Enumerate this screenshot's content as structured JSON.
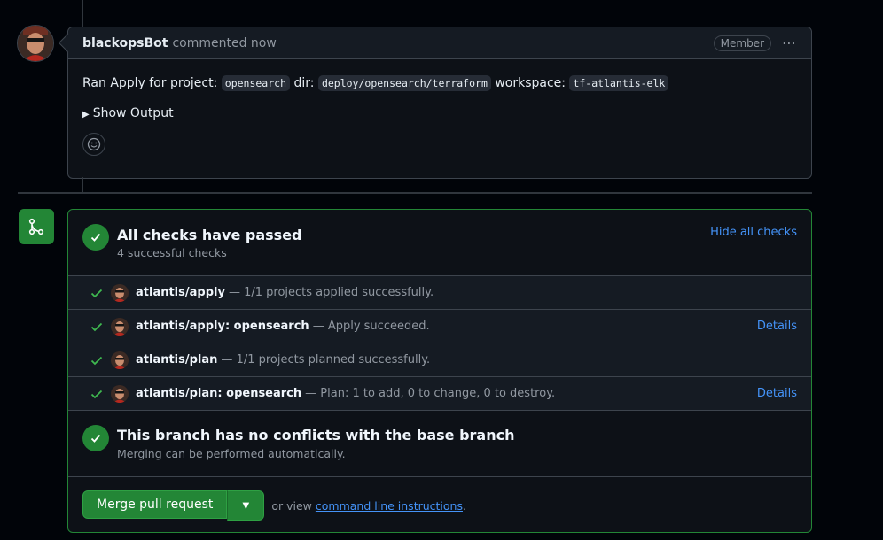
{
  "comment": {
    "author": "blackopsBot",
    "meta": "commented now",
    "badge": "Member",
    "menu_icon": "kebab-horizontal-icon",
    "body": {
      "prefix": "Ran Apply for project:",
      "project": "opensearch",
      "dir_label": "dir:",
      "dir": "deploy/opensearch/terraform",
      "workspace_label": "workspace:",
      "workspace": "tf-atlantis-elk"
    },
    "details_label": "Show Output",
    "reaction_icon": "smiley-icon"
  },
  "merge": {
    "icon": "git-merge-icon",
    "checks": {
      "title": "All checks have passed",
      "subtitle": "4 successful checks",
      "hide_label": "Hide all checks",
      "items": [
        {
          "name": "atlantis/apply",
          "desc": "— 1/1 projects applied successfully.",
          "details": ""
        },
        {
          "name": "atlantis/apply: opensearch",
          "desc": "— Apply succeeded.",
          "details": "Details"
        },
        {
          "name": "atlantis/plan",
          "desc": "— 1/1 projects planned successfully.",
          "details": ""
        },
        {
          "name": "atlantis/plan: opensearch",
          "desc": "— Plan: 1 to add, 0 to change, 0 to destroy.",
          "details": "Details"
        }
      ]
    },
    "conflict": {
      "title": "This branch has no conflicts with the base branch",
      "subtitle": "Merging can be performed automatically."
    },
    "button_label": "Merge pull request",
    "or_view": "or view",
    "cli_link": "command line instructions",
    "period": "."
  },
  "colors": {
    "success": "#238636",
    "link": "#4493f8",
    "background": "#010409"
  }
}
